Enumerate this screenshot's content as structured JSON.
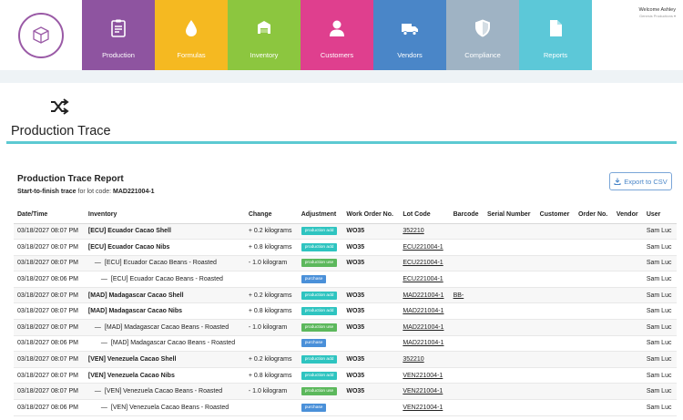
{
  "nav": {
    "tiles": [
      {
        "label": "Production",
        "color": "#8e54a0",
        "icon": "clipboard-icon"
      },
      {
        "label": "Formulas",
        "color": "#f5b921",
        "icon": "droplet-icon"
      },
      {
        "label": "Inventory",
        "color": "#8cc63f",
        "icon": "inventory-icon"
      },
      {
        "label": "Customers",
        "color": "#df3f8e",
        "icon": "person-icon"
      },
      {
        "label": "Vendors",
        "color": "#4a86c8",
        "icon": "truck-icon"
      },
      {
        "label": "Compliance",
        "color": "#9fb3c4",
        "icon": "shield-icon"
      },
      {
        "label": "Reports",
        "color": "#5cc8d8",
        "icon": "document-icon"
      }
    ],
    "welcome": "Welcome Ashley",
    "company": "Genesis Productions ▾"
  },
  "page": {
    "title": "Production Trace"
  },
  "report": {
    "title": "Production Trace Report",
    "subtitle_bold": "Start-to-finish trace",
    "subtitle_text": " for lot code: ",
    "lot_code": "MAD221004-1",
    "export_label": "Export to CSV"
  },
  "table": {
    "headers": [
      "Date/Time",
      "Inventory",
      "Change",
      "Adjustment",
      "Work Order No.",
      "Lot Code",
      "Barcode",
      "Serial Number",
      "Customer",
      "Order No.",
      "Vendor",
      "User"
    ],
    "rows": [
      {
        "date": "03/18/2027 08:07 PM",
        "indent": 0,
        "inventory": "[ECU] Ecuador Cacao Shell",
        "change": "+ 0.2 kilograms",
        "adjustment": "production add",
        "adj_type": "add",
        "wo": "WO35",
        "lot": "352210",
        "barcode": "",
        "user": "Sam Luc"
      },
      {
        "date": "03/18/2027 08:07 PM",
        "indent": 0,
        "inventory": "[ECU] Ecuador Cacao Nibs",
        "change": "+ 0.8 kilograms",
        "adjustment": "production add",
        "adj_type": "add",
        "wo": "WO35",
        "lot": "ECU221004-1",
        "barcode": "",
        "user": "Sam Luc"
      },
      {
        "date": "03/18/2027 08:07 PM",
        "indent": 1,
        "inventory": "[ECU] Ecuador Cacao Beans - Roasted",
        "change": "- 1.0 kilogram",
        "adjustment": "production use",
        "adj_type": "use",
        "wo": "WO35",
        "lot": "ECU221004-1",
        "barcode": "",
        "user": "Sam Luc"
      },
      {
        "date": "03/18/2027 08:06 PM",
        "indent": 2,
        "inventory": "[ECU] Ecuador Cacao Beans - Roasted",
        "change": "",
        "adjustment": "purchase",
        "adj_type": "purchase",
        "wo": "",
        "lot": "ECU221004-1",
        "barcode": "",
        "user": "Sam Luc"
      },
      {
        "date": "03/18/2027 08:07 PM",
        "indent": 0,
        "inventory": "[MAD] Madagascar Cacao Shell",
        "change": "+ 0.2 kilograms",
        "adjustment": "production add",
        "adj_type": "add",
        "wo": "WO35",
        "lot": "MAD221004-1",
        "barcode": "BB-",
        "user": "Sam Luc"
      },
      {
        "date": "03/18/2027 08:07 PM",
        "indent": 0,
        "inventory": "[MAD] Madagascar Cacao Nibs",
        "change": "+ 0.8 kilograms",
        "adjustment": "production add",
        "adj_type": "add",
        "wo": "WO35",
        "lot": "MAD221004-1",
        "barcode": "",
        "user": "Sam Luc"
      },
      {
        "date": "03/18/2027 08:07 PM",
        "indent": 1,
        "inventory": "[MAD] Madagascar Cacao Beans - Roasted",
        "change": "- 1.0 kilogram",
        "adjustment": "production use",
        "adj_type": "use",
        "wo": "WO35",
        "lot": "MAD221004-1",
        "barcode": "",
        "user": "Sam Luc"
      },
      {
        "date": "03/18/2027 08:06 PM",
        "indent": 2,
        "inventory": "[MAD] Madagascar Cacao Beans - Roasted",
        "change": "",
        "adjustment": "purchase",
        "adj_type": "purchase",
        "wo": "",
        "lot": "MAD221004-1",
        "barcode": "",
        "user": "Sam Luc"
      },
      {
        "date": "03/18/2027 08:07 PM",
        "indent": 0,
        "inventory": "[VEN] Venezuela Cacao Shell",
        "change": "+ 0.2 kilograms",
        "adjustment": "production add",
        "adj_type": "add",
        "wo": "WO35",
        "lot": "352210",
        "barcode": "",
        "user": "Sam Luc"
      },
      {
        "date": "03/18/2027 08:07 PM",
        "indent": 0,
        "inventory": "[VEN] Venezuela Cacao Nibs",
        "change": "+ 0.8 kilograms",
        "adjustment": "production add",
        "adj_type": "add",
        "wo": "WO35",
        "lot": "VEN221004-1",
        "barcode": "",
        "user": "Sam Luc"
      },
      {
        "date": "03/18/2027 08:07 PM",
        "indent": 1,
        "inventory": "[VEN] Venezuela Cacao Beans - Roasted",
        "change": "- 1.0 kilogram",
        "adjustment": "production use",
        "adj_type": "use",
        "wo": "WO35",
        "lot": "VEN221004-1",
        "barcode": "",
        "user": "Sam Luc"
      },
      {
        "date": "03/18/2027 08:06 PM",
        "indent": 2,
        "inventory": "[VEN] Venezuela Cacao Beans - Roasted",
        "change": "",
        "adjustment": "purchase",
        "adj_type": "purchase",
        "wo": "",
        "lot": "VEN221004-1",
        "barcode": "",
        "user": "Sam Luc"
      }
    ]
  }
}
